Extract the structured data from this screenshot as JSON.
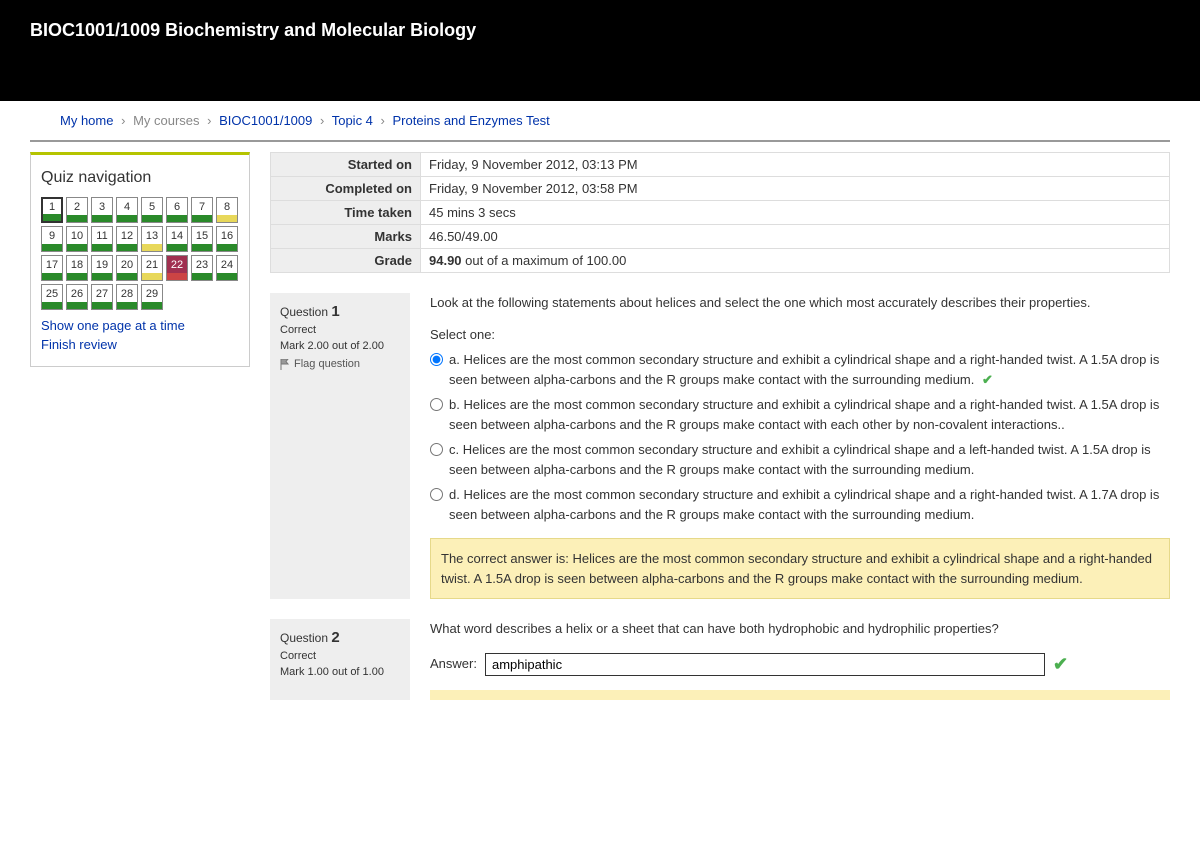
{
  "header": {
    "title": "BIOC1001/1009 Biochemistry and Molecular Biology"
  },
  "breadcrumb": {
    "home": "My home",
    "courses": "My courses",
    "course": "BIOC1001/1009",
    "topic": "Topic 4",
    "page": "Proteins and Enzymes Test"
  },
  "sidebar": {
    "title": "Quiz navigation",
    "cells": [
      {
        "n": "1",
        "state": "green",
        "current": true
      },
      {
        "n": "2",
        "state": "green"
      },
      {
        "n": "3",
        "state": "green"
      },
      {
        "n": "4",
        "state": "green"
      },
      {
        "n": "5",
        "state": "green"
      },
      {
        "n": "6",
        "state": "green"
      },
      {
        "n": "7",
        "state": "green"
      },
      {
        "n": "8",
        "state": "yellow"
      },
      {
        "n": "9",
        "state": "green"
      },
      {
        "n": "10",
        "state": "green"
      },
      {
        "n": "11",
        "state": "green"
      },
      {
        "n": "12",
        "state": "green"
      },
      {
        "n": "13",
        "state": "yellow"
      },
      {
        "n": "14",
        "state": "green"
      },
      {
        "n": "15",
        "state": "green"
      },
      {
        "n": "16",
        "state": "green"
      },
      {
        "n": "17",
        "state": "green"
      },
      {
        "n": "18",
        "state": "green"
      },
      {
        "n": "19",
        "state": "green"
      },
      {
        "n": "20",
        "state": "green"
      },
      {
        "n": "21",
        "state": "yellow"
      },
      {
        "n": "22",
        "state": "red",
        "flagged": true
      },
      {
        "n": "23",
        "state": "green"
      },
      {
        "n": "24",
        "state": "green"
      },
      {
        "n": "25",
        "state": "green"
      },
      {
        "n": "26",
        "state": "green"
      },
      {
        "n": "27",
        "state": "green"
      },
      {
        "n": "28",
        "state": "green"
      },
      {
        "n": "29",
        "state": "green"
      }
    ],
    "link_onepage": "Show one page at a time",
    "link_finish": "Finish review"
  },
  "summary": {
    "started_label": "Started on",
    "started_val": "Friday, 9 November 2012, 03:13 PM",
    "completed_label": "Completed on",
    "completed_val": "Friday, 9 November 2012, 03:58 PM",
    "taken_label": "Time taken",
    "taken_val": "45 mins 3 secs",
    "marks_label": "Marks",
    "marks_val": "46.50/49.00",
    "grade_label": "Grade",
    "grade_bold": "94.90",
    "grade_rest": " out of a maximum of 100.00"
  },
  "q1": {
    "label": "Question",
    "num": "1",
    "state": "Correct",
    "mark": "Mark 2.00 out of 2.00",
    "flag": "Flag question",
    "text": "Look at the following statements about helices and select the one which most accurately describes their properties.",
    "select_one": "Select one:",
    "opt_a": "a. Helices are the most common secondary structure and exhibit a  cylindrical shape and a right-handed twist. A 1.5A drop is seen between alpha-carbons and the R groups make contact with the surrounding medium.",
    "opt_b": "b. Helices are the most common secondary structure and exhibit a  cylindrical shape and a right-handed twist. A 1.5A drop is seen between alpha-carbons and the R groups make contact with each other by non-covalent interactions..",
    "opt_c": "c. Helices are the most common secondary structure and exhibit a  cylindrical shape and a left-handed twist. A 1.5A drop is seen between alpha-carbons and the R groups make contact with the surrounding medium.",
    "opt_d": "d. Helices are the most common secondary structure and exhibit a  cylindrical shape and a right-handed twist. A 1.7A drop is seen between alpha-carbons and the R groups make contact with the surrounding medium.",
    "feedback": "The correct answer is: Helices are the most common secondary structure and exhibit a  cylindrical shape and a right-handed twist. A 1.5A drop is seen between alpha-carbons and the R groups make contact with the surrounding medium."
  },
  "q2": {
    "label": "Question",
    "num": "2",
    "state": "Correct",
    "mark": "Mark 1.00 out of 1.00",
    "text": "What word describes a helix or a sheet that can have both hydrophobic and hydrophilic properties?",
    "answer_label": "Answer:",
    "answer_value": "amphipathic"
  }
}
